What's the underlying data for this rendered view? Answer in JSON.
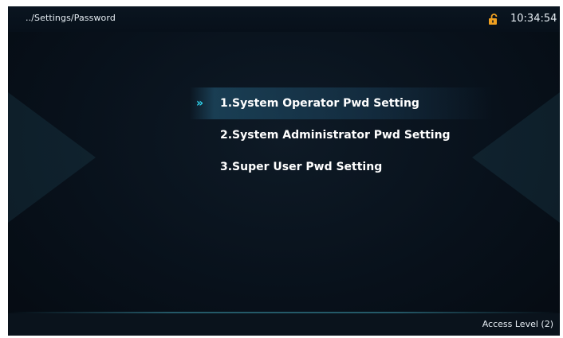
{
  "header": {
    "breadcrumb": "../Settings/Password",
    "lock_icon": "unlocked-padlock-icon",
    "time": "10:34:54"
  },
  "menu": {
    "selected_index": 0,
    "selector_glyph": "»",
    "items": [
      {
        "label": "1.System Operator Pwd Setting"
      },
      {
        "label": "2.System Administrator Pwd Setting"
      },
      {
        "label": "3.Super User Pwd Setting"
      }
    ]
  },
  "footer": {
    "access_level": "Access Level  (2)"
  },
  "colors": {
    "background": "#08111b",
    "accent": "#2fd6f0",
    "lock": "#f0a020",
    "text": "#ffffff"
  }
}
